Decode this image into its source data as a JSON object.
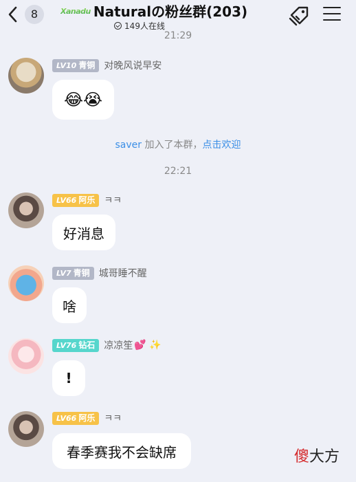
{
  "header": {
    "back_count": "8",
    "logo_text": "Xanadu",
    "group_title": "Naturalの粉丝群(203)",
    "online_text": "149人在线"
  },
  "messages": [
    {
      "time": "21:29"
    },
    {
      "level": "LV10",
      "level_title": "青铜",
      "nickname": "对晚风说早安",
      "content": "😂😭"
    },
    {
      "system_user": "saver",
      "system_text": " 加入了本群，",
      "system_link": "点击欢迎"
    },
    {
      "time": "22:21"
    },
    {
      "level": "LV66",
      "level_title": "阿乐",
      "nickname": "ㅋㅋ",
      "content": "好消息"
    },
    {
      "level": "LV7",
      "level_title": "青铜",
      "nickname": "城哥睡不醒",
      "content": "啥"
    },
    {
      "level": "LV76",
      "level_title": "钻石",
      "nickname": "凉凉笙",
      "nickname_emoji": "💕 ✨",
      "content": "!"
    },
    {
      "level": "LV66",
      "level_title": "阿乐",
      "nickname": "ㅋㅋ",
      "content": "春季赛我不会缺席"
    }
  ],
  "top_time": "21:29",
  "watermark": {
    "red": "傻",
    "black": "大方"
  },
  "colors": {
    "background": "#eef0f7",
    "link": "#3a8ee6",
    "lvl_silver": "#b2b7c7",
    "lvl_gold": "#f7c248",
    "lvl_cyan": "#56d6cc"
  }
}
